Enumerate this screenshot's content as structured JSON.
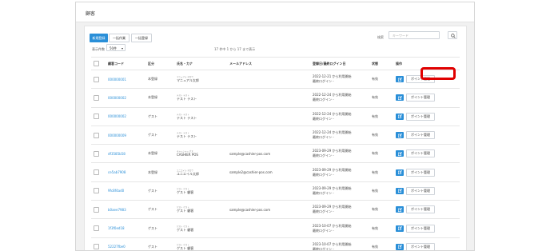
{
  "page": {
    "title": "顧客"
  },
  "toolbar": {
    "new_label": "新規登録",
    "edit_all_label": "一括作業",
    "register_all_label": "一括登録",
    "search_label": "検索",
    "search_placeholder": "キーワード"
  },
  "pager": {
    "per_page_label": "表示件数",
    "per_page_value": "50件",
    "count_text": "17 件中 1 から 17 まで表示"
  },
  "table": {
    "headers": [
      "顧客コード",
      "区分",
      "氏名・カナ",
      "メールアドレス",
      "登録日/最終ログイン日",
      "状態",
      "操作"
    ],
    "rows": [
      {
        "code": "000000001",
        "type": "本登録",
        "kana": "マニュアル タロウ",
        "name": "マニュアル太郎",
        "email": "",
        "dates": [
          "2022-12-21 から利用開始",
          "最終ログイン -"
        ],
        "status": "有効"
      },
      {
        "code": "000000002",
        "type": "本登録",
        "kana": "テスト テスト",
        "name": "テスト テスト",
        "email": "",
        "dates": [
          "2022-12-24 から利用開始",
          "最終ログイン -"
        ],
        "status": "有効"
      },
      {
        "code": "000000002",
        "type": "ゲスト",
        "kana": "テスト テスト",
        "name": "テスト テスト",
        "email": "",
        "dates": [
          "2022-12-24 から利用開始",
          "最終ログイン -"
        ],
        "status": "有効"
      },
      {
        "code": "000000009",
        "type": "ゲスト",
        "kana": "テスト テスト",
        "name": "テスト テスト",
        "email": "",
        "dates": [
          "2022-12-24 から利用開始",
          "最終ログイン -"
        ],
        "status": "有効"
      },
      {
        "code": "df3585b58",
        "type": "本登録",
        "kana": "キャッシャー ポス",
        "name": "CASHIER POS",
        "email": "sample@cashier-pos.com",
        "dates": [
          "2023-09-29 から利用開始",
          "最終ログイン -"
        ],
        "status": "有効"
      },
      {
        "code": "ce5ab7908",
        "type": "本登録",
        "kana": "ユニエイル タロウ",
        "name": "ユニエイル太郎",
        "email": "sample2@cashier-pos.com",
        "dates": [
          "2023-09-29 から利用開始",
          "最終ログイン -"
        ],
        "status": "有効"
      },
      {
        "code": "9fc8f4ad0",
        "type": "ゲスト",
        "kana": "ゲスト ゲスト",
        "name": "ゲスト 顧客",
        "email": "",
        "dates": [
          "2023-09-29 から利用開始",
          "最終ログイン -"
        ],
        "status": "有効"
      },
      {
        "code": "b0aee7983",
        "type": "ゲスト",
        "kana": "ゲスト ゲスト",
        "name": "ゲスト 顧客",
        "email": "sample@cashier-pos.com",
        "dates": [
          "2023-09-29 から利用開始",
          "最終ログイン -"
        ],
        "status": "有効"
      },
      {
        "code": "1f3f0ed18",
        "type": "ゲスト",
        "kana": "ゲスト ゲスト",
        "name": "ゲスト 顧客",
        "email": "",
        "dates": [
          "2023-10-07 から利用開始",
          "最終ログイン -"
        ],
        "status": "有効"
      },
      {
        "code": "52227fbe0",
        "type": "ゲスト",
        "kana": "ゲスト ゲスト",
        "name": "ゲスト 顧客",
        "email": "",
        "dates": [
          "2023-10-07 から利用開始",
          "最終ログイン -"
        ],
        "status": "有効"
      }
    ],
    "point_button_label": "ポイント管理"
  },
  "colors": {
    "accent": "#2a8fd8",
    "highlight": "#e00000"
  }
}
